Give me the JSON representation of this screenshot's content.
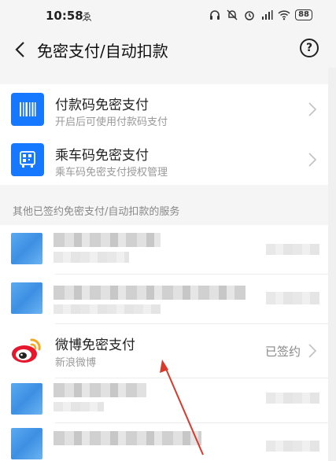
{
  "status_bar": {
    "time": "10:58",
    "extra": "ゑ",
    "battery": "88"
  },
  "header": {
    "title": "免密支付/自动扣款"
  },
  "top_items": [
    {
      "title": "付款码免密支付",
      "subtitle": "开启后可使用付款码支付",
      "icon": "barcode-icon"
    },
    {
      "title": "乘车码免密支付",
      "subtitle": "乘车码免密支付授权管理",
      "icon": "bus-qr-icon"
    }
  ],
  "section": {
    "header": "其他已签约免密支付/自动扣款的服务"
  },
  "services": [
    {
      "title": "微博免密支付",
      "subtitle": "新浪微博",
      "status": "已签约",
      "icon": "weibo-icon"
    }
  ],
  "colors": {
    "accent": "#1677ff",
    "arrow": "#d9392b"
  }
}
